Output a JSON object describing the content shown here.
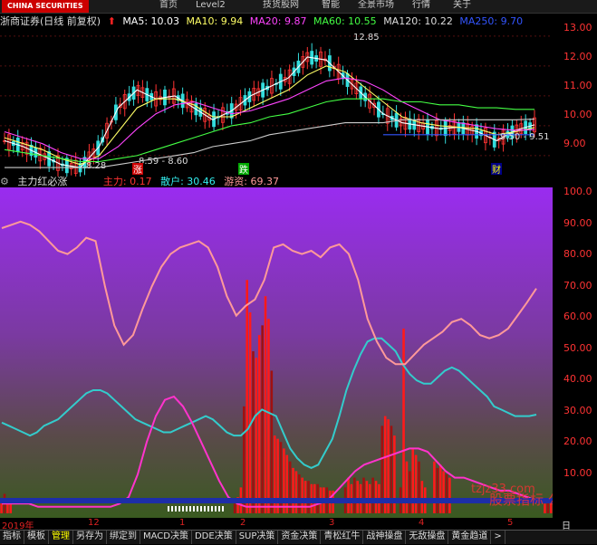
{
  "topbar": {
    "logo": "CHINA SECURITIES",
    "menu": [
      "首页",
      "Level2",
      "技货股网",
      "智能",
      "全景市场",
      "行情",
      "关于"
    ]
  },
  "infobar": {
    "title": "浙商证券(日线 前复权)",
    "ma5": "MA5: 10.03",
    "ma10": "MA10: 9.94",
    "ma20": "MA20: 9.87",
    "ma60": "MA60: 10.55",
    "ma120": "MA120: 10.22",
    "ma250": "MA250: 9.70",
    "colors": {
      "ma5": "#ffffff",
      "ma10": "#ffff66",
      "ma20": "#ff44ff",
      "ma60": "#44ff44",
      "ma120": "#dddddd",
      "ma250": "#3355ff"
    }
  },
  "price_chart": {
    "yticks": [
      "13.00",
      "12.00",
      "11.00",
      "10.00",
      "9.00"
    ],
    "annotations": {
      "high": "12.85",
      "low1": "8.28",
      "low2": "8.59 - 8.60",
      "range": "9.50 - 9.51"
    },
    "markers": {
      "rise": "涨",
      "fall": "跌",
      "fortune": "财"
    }
  },
  "indicator": {
    "name": "主力红必涨",
    "main_label": "主力: 0.17",
    "retail_label": "散户: 30.46",
    "hot_label": "游资: 69.37",
    "yticks": [
      "100.0",
      "90.00",
      "80.00",
      "70.00",
      "60.00",
      "50.00",
      "40.00",
      "30.00",
      "20.00",
      "10.00"
    ]
  },
  "xaxis": {
    "labels": [
      "2019年",
      "12",
      "1",
      "2",
      "3",
      "4",
      "5"
    ],
    "right": "日线"
  },
  "tabs": [
    "指标",
    "模板",
    "管理",
    "另存为",
    "绑定到",
    "MACD决策",
    "DDE决策",
    "SUP决策",
    "资金决策",
    "青松红牛",
    "战神操盘",
    "无敌操盘",
    "黄金趋道",
    ">"
  ],
  "watermark": {
    "site": "tzjz33.com",
    "text": "股票指标 公式"
  },
  "chart_data": [
    {
      "type": "line",
      "title": "",
      "series": [
        {
          "name": "MA5",
          "values": [
            9.5,
            9.3,
            9.0,
            8.7,
            8.6,
            9.3,
            10.6,
            11.2,
            10.9,
            11.0,
            10.6,
            10.2,
            10.5,
            11.0,
            11.3,
            11.6,
            12.3,
            12.2,
            11.6,
            11.0,
            10.4,
            10.1,
            10.0,
            9.9,
            9.95,
            9.8,
            9.5,
            9.85,
            10.03
          ]
        },
        {
          "name": "MA10",
          "values": [
            9.6,
            9.4,
            9.2,
            8.9,
            8.7,
            9.0,
            9.8,
            10.6,
            10.9,
            10.9,
            10.7,
            10.3,
            10.3,
            10.6,
            10.9,
            11.2,
            11.7,
            12.0,
            11.8,
            11.3,
            10.8,
            10.3,
            10.1,
            10.0,
            9.95,
            9.9,
            9.7,
            9.8,
            9.94
          ]
        },
        {
          "name": "MA20",
          "values": [
            9.8,
            9.6,
            9.4,
            9.1,
            8.9,
            8.9,
            9.3,
            9.9,
            10.4,
            10.7,
            10.8,
            10.6,
            10.4,
            10.5,
            10.7,
            10.9,
            11.2,
            11.5,
            11.6,
            11.5,
            11.2,
            10.8,
            10.5,
            10.2,
            10.1,
            10.0,
            9.9,
            9.85,
            9.87
          ]
        },
        {
          "name": "MA60",
          "values": [
            9.2,
            9.1,
            9.0,
            8.9,
            8.8,
            8.8,
            8.9,
            9.0,
            9.2,
            9.4,
            9.6,
            9.8,
            10.0,
            10.1,
            10.3,
            10.4,
            10.6,
            10.8,
            10.9,
            10.9,
            10.9,
            10.8,
            10.8,
            10.7,
            10.7,
            10.6,
            10.6,
            10.55,
            10.55
          ]
        },
        {
          "name": "MA120",
          "values": [
            8.6,
            8.6,
            8.6,
            8.6,
            8.6,
            8.6,
            8.7,
            8.8,
            8.9,
            9.0,
            9.1,
            9.3,
            9.4,
            9.5,
            9.7,
            9.8,
            9.9,
            10.0,
            10.1,
            10.1,
            10.1,
            10.2,
            10.2,
            10.2,
            10.2,
            10.2,
            10.2,
            10.2,
            10.22
          ]
        },
        {
          "name": "MA250",
          "values": [
            null,
            null,
            null,
            null,
            null,
            null,
            null,
            null,
            null,
            null,
            null,
            null,
            null,
            null,
            null,
            null,
            null,
            null,
            null,
            null,
            9.7,
            9.7,
            9.7,
            9.7,
            9.7,
            9.7,
            9.7,
            9.7,
            9.7
          ]
        }
      ],
      "ylim": [
        8.3,
        13.3
      ]
    },
    {
      "type": "bar",
      "title": "",
      "series": [
        {
          "name": "主力",
          "values": [
            4,
            6,
            4,
            3,
            0,
            0,
            0,
            0,
            0,
            0,
            0,
            0,
            0,
            0,
            0,
            0,
            0,
            0,
            0,
            0,
            0,
            0,
            0,
            0,
            0,
            0,
            0,
            0,
            0,
            0,
            0,
            0,
            0,
            0,
            0,
            0,
            0,
            0,
            0,
            0,
            0,
            0,
            0,
            0,
            0,
            0,
            0,
            0,
            0,
            0,
            0,
            0,
            0,
            0,
            0,
            0,
            0,
            0,
            0,
            0,
            0,
            0,
            0,
            0,
            0,
            0,
            0,
            0,
            0,
            0,
            0,
            0,
            0,
            0,
            0,
            0,
            3,
            5,
            8,
            33,
            72,
            62,
            50,
            48,
            55,
            58,
            67,
            60,
            44,
            24,
            23,
            22,
            20,
            18,
            16,
            14,
            13,
            12,
            11,
            10,
            10,
            9,
            9,
            9,
            8,
            8,
            8,
            7,
            7,
            0,
            0,
            0,
            8,
            11,
            9,
            11,
            10,
            9,
            11,
            10,
            9,
            11,
            10,
            9,
            27,
            30,
            29,
            27,
            24,
            0,
            8,
            57,
            16,
            13,
            20,
            18,
            16,
            10,
            8,
            0,
            0,
            16,
            14,
            15,
            13,
            12,
            11,
            0,
            0,
            0,
            0,
            0,
            0,
            0,
            0,
            0,
            0,
            0,
            0,
            0,
            0,
            0,
            0,
            0,
            0,
            0,
            0,
            0,
            0,
            0,
            0,
            0,
            0,
            0,
            0,
            0,
            0,
            3,
            4,
            3
          ]
        },
        {
          "name": "散户",
          "values": [
            28,
            27,
            26,
            25,
            24,
            25,
            27,
            28,
            29,
            31,
            33,
            35,
            37,
            38,
            38,
            37,
            35,
            33,
            31,
            29,
            28,
            27,
            26,
            25,
            25,
            26,
            27,
            28,
            29,
            30,
            29,
            27,
            25,
            24,
            24,
            26,
            30,
            32,
            31,
            30,
            25,
            20,
            17,
            15,
            14,
            15,
            19,
            23,
            30,
            38,
            44,
            49,
            53,
            54,
            54,
            52,
            50,
            46,
            43,
            41,
            40,
            40,
            42,
            44,
            45,
            44,
            42,
            40,
            38,
            36,
            33,
            32,
            31,
            30,
            30,
            30,
            30.46
          ]
        },
        {
          "name": "游资",
          "values": [
            88,
            89,
            90,
            89,
            87,
            84,
            81,
            80,
            82,
            85,
            84,
            70,
            58,
            52,
            55,
            63,
            70,
            76,
            80,
            82,
            83,
            84,
            82,
            76,
            67,
            61,
            64,
            66,
            72,
            82,
            83,
            81,
            80,
            81,
            79,
            82,
            83,
            80,
            72,
            60,
            53,
            48,
            46,
            46,
            49,
            52,
            54,
            56,
            59,
            60,
            58,
            55,
            54,
            55,
            57,
            61,
            65,
            69.37
          ]
        }
      ],
      "ylim": [
        0,
        100
      ]
    }
  ]
}
